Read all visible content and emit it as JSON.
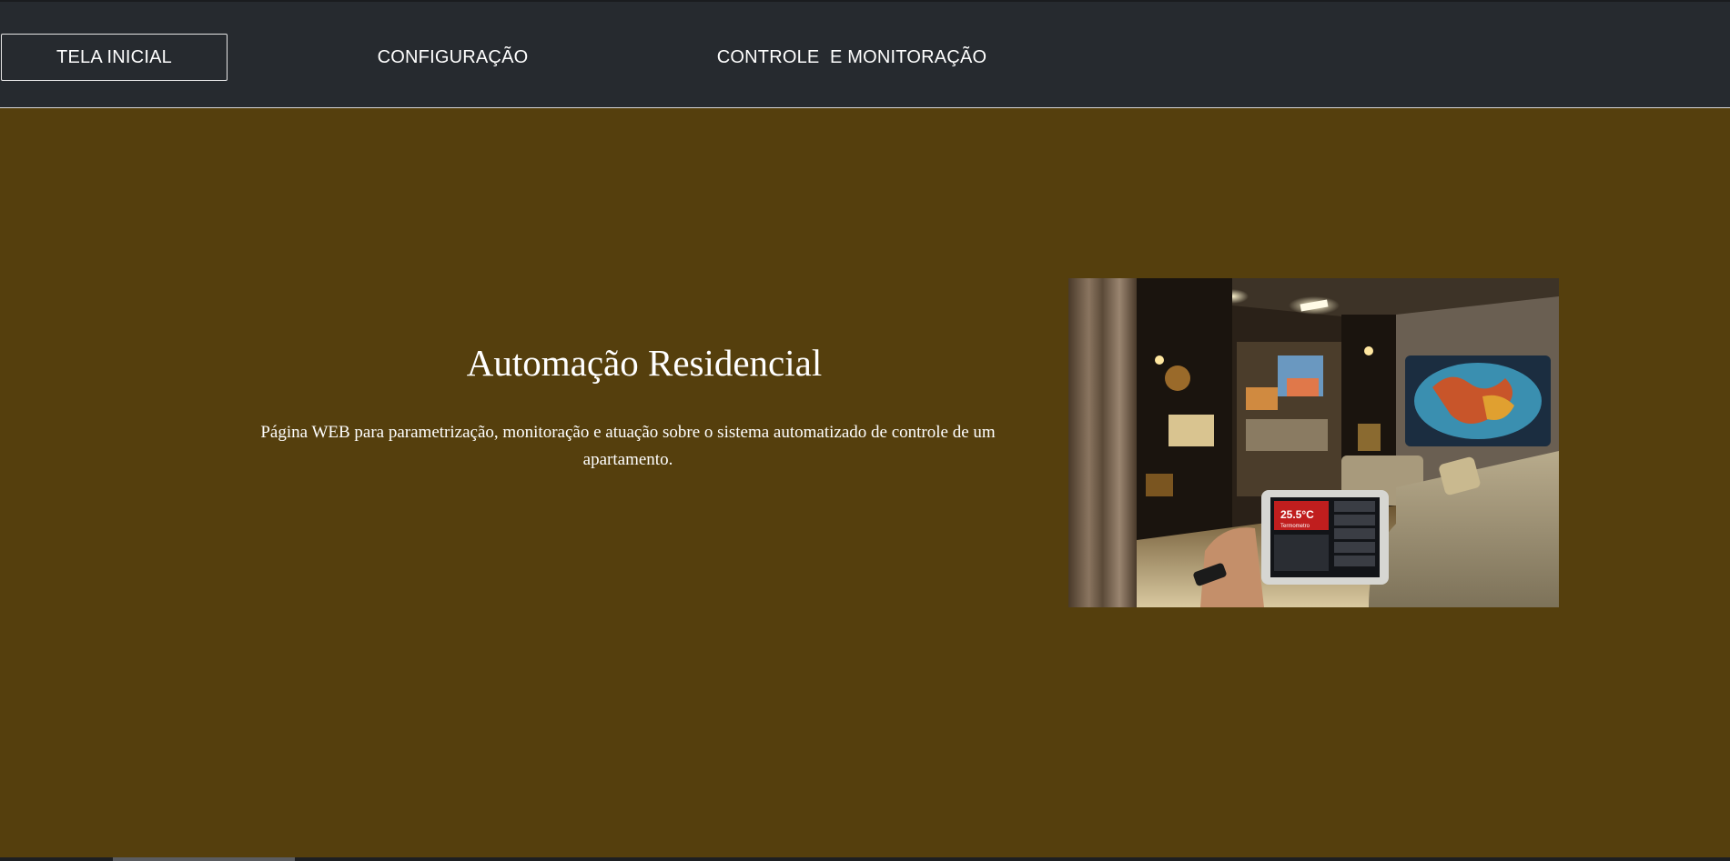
{
  "nav": {
    "items": [
      {
        "label": "TELA INICIAL",
        "active": true
      },
      {
        "label": "CONFIGURAÇÃO",
        "active": false
      },
      {
        "label": "CONTROLE  E MONITORAÇÃO",
        "active": false
      }
    ]
  },
  "hero": {
    "title": "Automação Residencial",
    "description": "Página WEB para parametrização, monitoração e atuação sobre o sistema automatizado de controle de um apartamento.",
    "tablet_temperature": "25.5°C",
    "tablet_caption": "Termometro"
  },
  "colors": {
    "navbar_bg": "#262a2f",
    "page_bg": "#553f0d",
    "text": "#ffffff"
  }
}
